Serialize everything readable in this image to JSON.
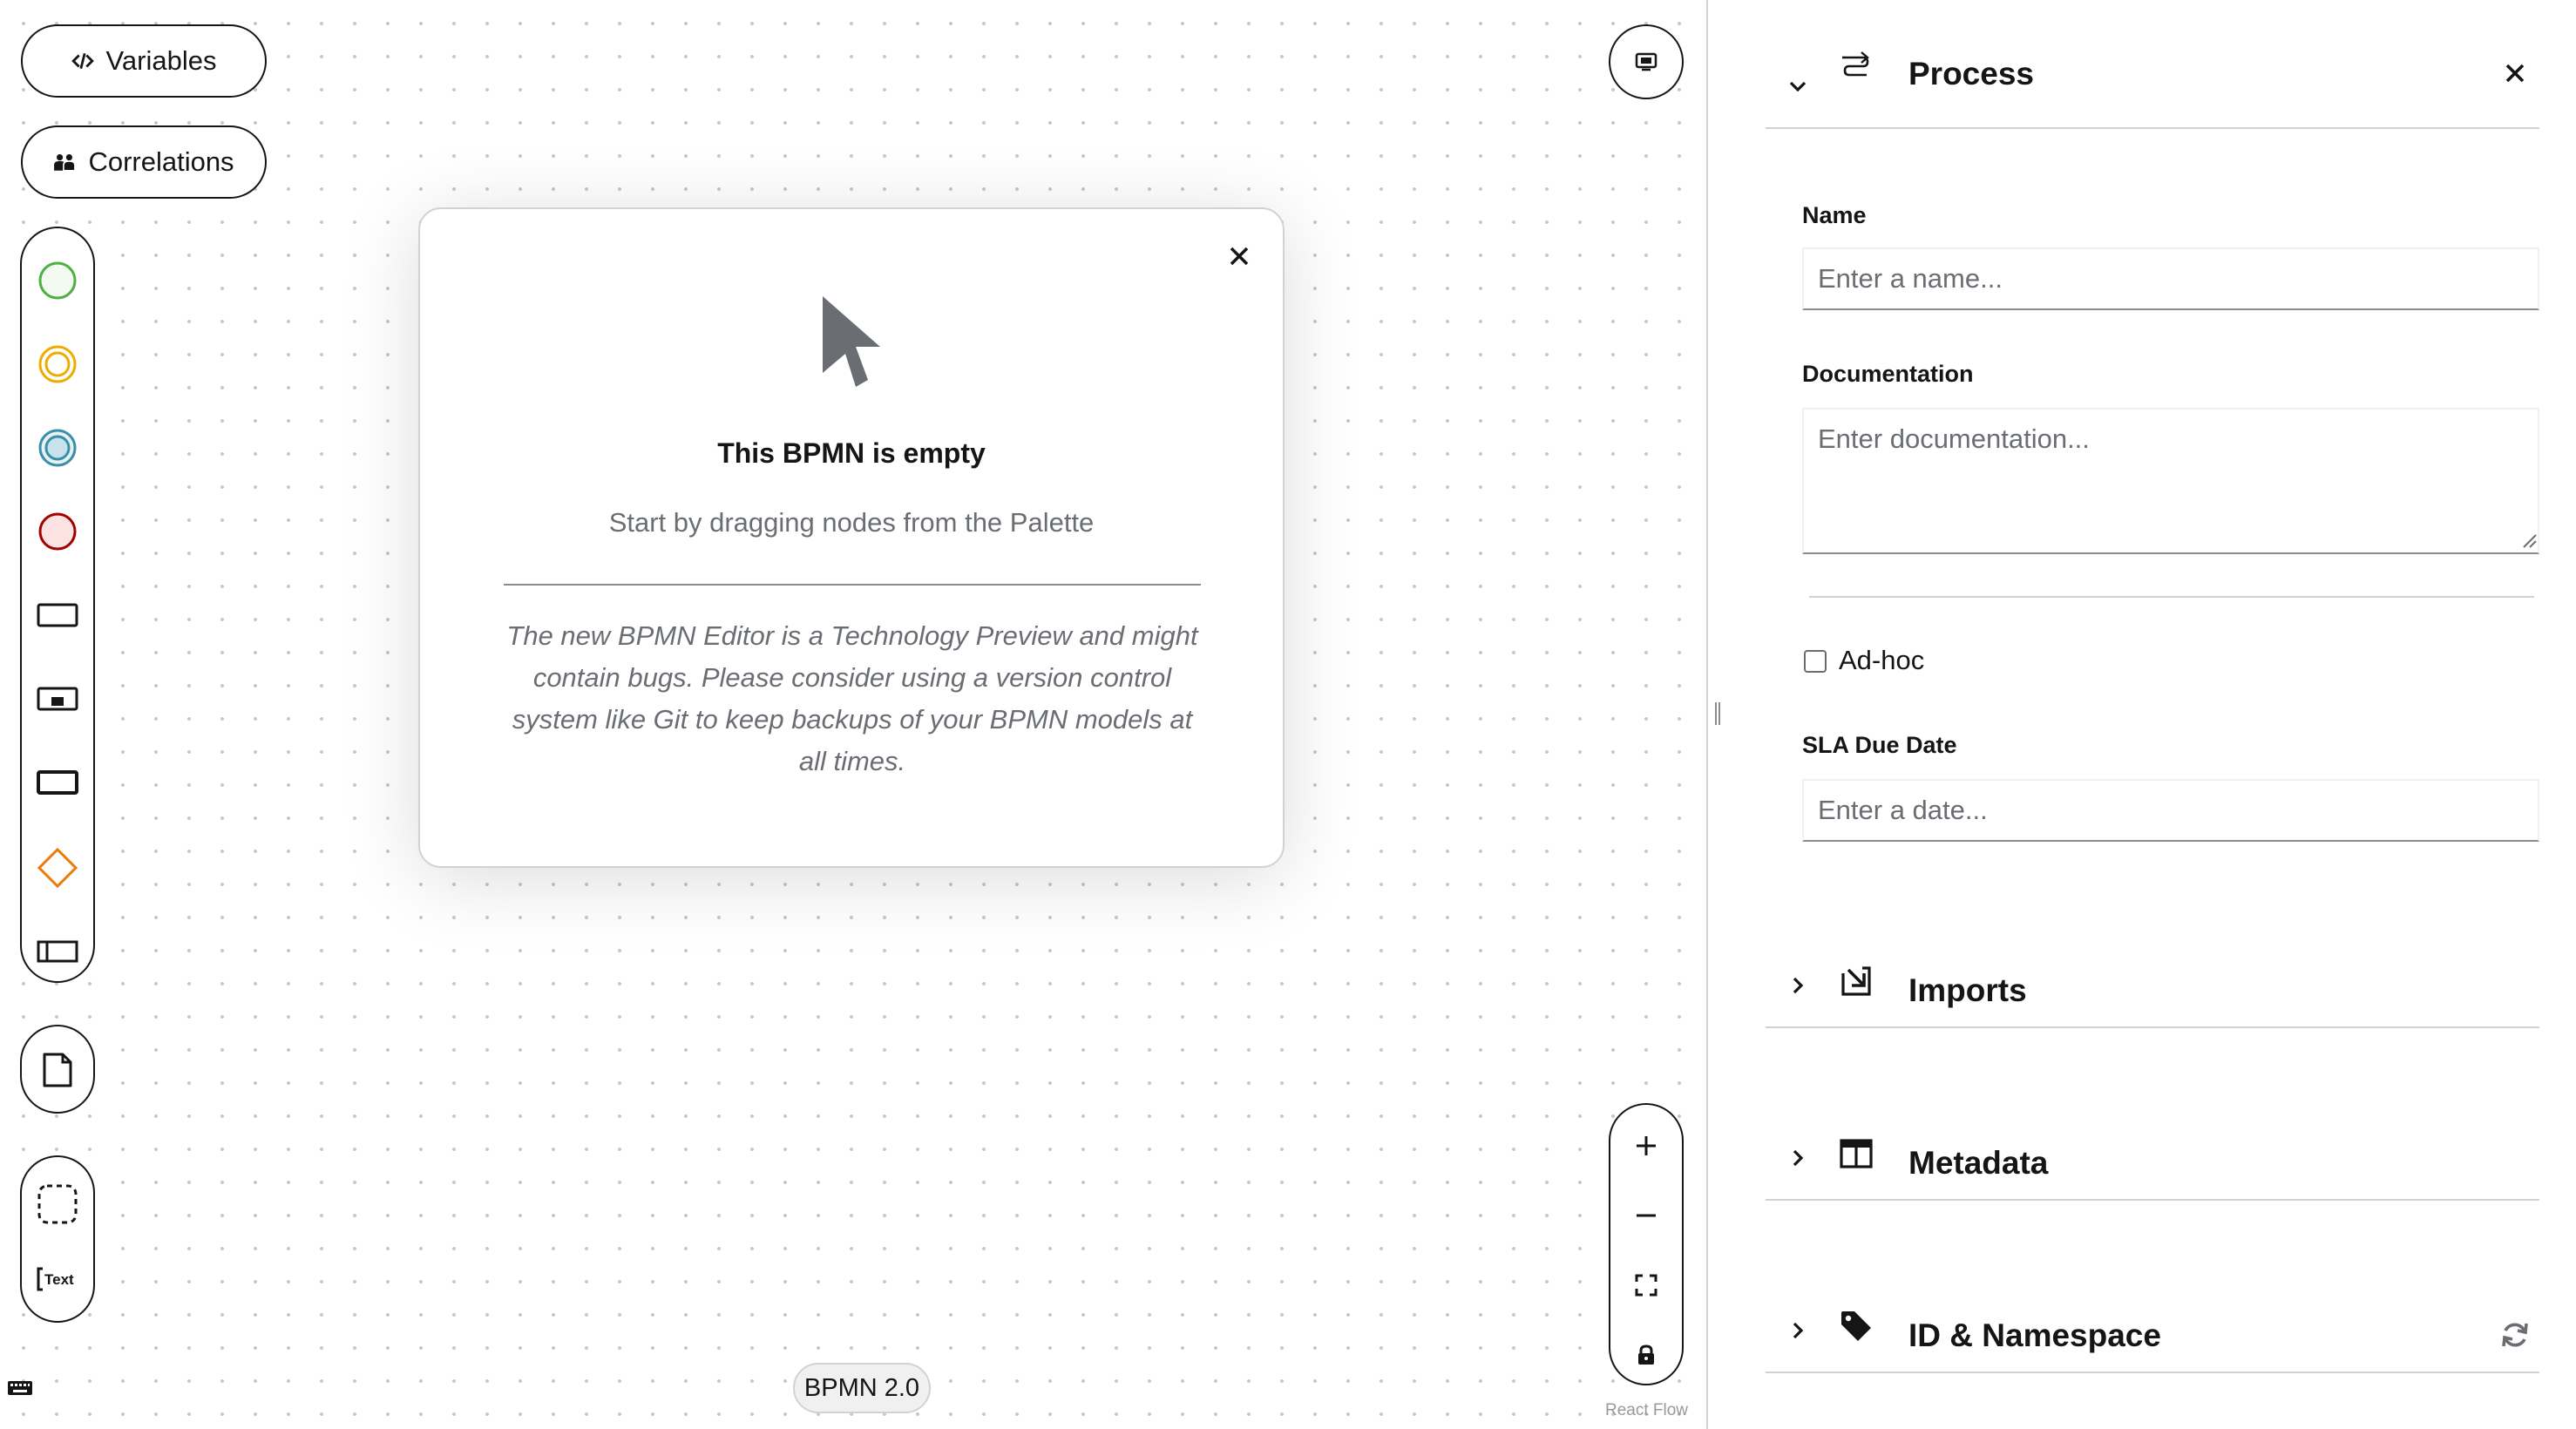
{
  "canvas": {
    "variables_label": "Variables",
    "correlations_label": "Correlations",
    "palette_icons": [
      "start-event-icon",
      "intermediate-catch-event-icon",
      "intermediate-throw-event-icon",
      "end-event-icon",
      "task-icon",
      "subprocess-icon",
      "call-activity-icon",
      "gateway-icon",
      "lane-icon"
    ],
    "artifact_icons": [
      "data-object-icon",
      "group-icon",
      "text-annotation-icon"
    ],
    "text_annotation_label": "Text",
    "bpmn_version": "BPMN 2.0",
    "react_flow_attribution": "React Flow",
    "colors": {
      "start_event": "#4cb140",
      "intermediate_catch": "#f0ab00",
      "intermediate_throw": "#3a8fa8",
      "end_event": "#a30000",
      "end_event_fill": "#fce3e3",
      "gateway": "#ec7a08"
    }
  },
  "empty_state": {
    "title": "This BPMN is empty",
    "subtitle": "Start by dragging nodes from the Palette",
    "note": "The new BPMN Editor is a Technology Preview and might contain bugs. Please consider using a version control system like Git to keep backups of your BPMN models at all times."
  },
  "panel": {
    "process": {
      "title": "Process",
      "name_label": "Name",
      "name_placeholder": "Enter a name...",
      "documentation_label": "Documentation",
      "documentation_placeholder": "Enter documentation...",
      "adhoc_label": "Ad-hoc",
      "adhoc_checked": false,
      "sla_label": "SLA Due Date",
      "sla_placeholder": "Enter a date..."
    },
    "sections": [
      {
        "title": "Imports",
        "icon": "import-icon",
        "expanded": false
      },
      {
        "title": "Metadata",
        "icon": "table-icon",
        "expanded": false
      },
      {
        "title": "ID & Namespace",
        "icon": "tag-icon",
        "expanded": false
      }
    ]
  }
}
